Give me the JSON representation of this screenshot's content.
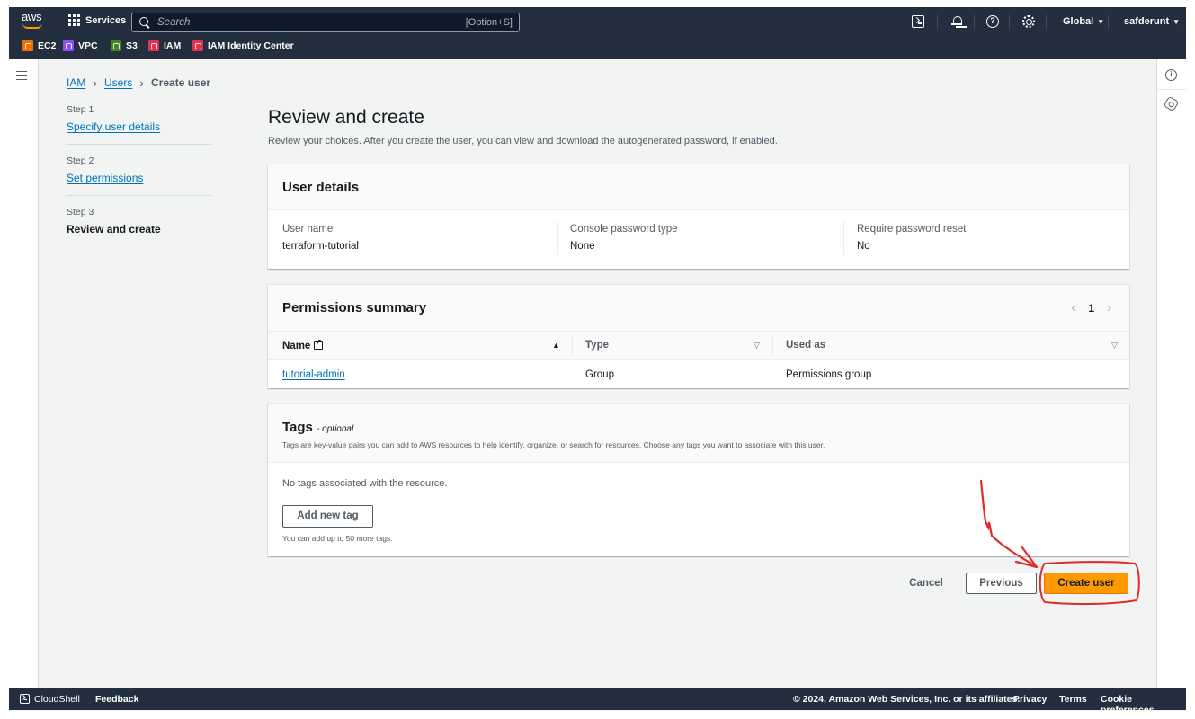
{
  "topnav": {
    "logo": "aws",
    "services_label": "Services",
    "search": {
      "placeholder": "Search",
      "shortcut": "[Option+S]"
    },
    "icons": [
      "cloudshell-icon",
      "bell-icon",
      "help-icon",
      "gear-icon"
    ],
    "region": "Global",
    "account": "safderunt",
    "favorites": [
      {
        "label": "EC2",
        "color": "#ed7100"
      },
      {
        "label": "VPC",
        "color": "#8c4fff"
      },
      {
        "label": "S3",
        "color": "#3f8624"
      },
      {
        "label": "IAM",
        "color": "#dd344c"
      },
      {
        "label": "IAM Identity Center",
        "color": "#dd344c"
      }
    ]
  },
  "breadcrumb": {
    "items": [
      {
        "label": "IAM",
        "link": true
      },
      {
        "label": "Users",
        "link": true
      },
      {
        "label": "Create user",
        "link": false
      }
    ]
  },
  "steps": [
    {
      "number": "Step 1",
      "label": "Specify user details",
      "state": "link"
    },
    {
      "number": "Step 2",
      "label": "Set permissions",
      "state": "link"
    },
    {
      "number": "Step 3",
      "label": "Review and create",
      "state": "current"
    }
  ],
  "page": {
    "title": "Review and create",
    "description": "Review your choices. After you create the user, you can view and download the autogenerated password, if enabled."
  },
  "user_details": {
    "title": "User details",
    "fields": [
      {
        "key": "User name",
        "value": "terraform-tutorial"
      },
      {
        "key": "Console password type",
        "value": "None"
      },
      {
        "key": "Require password reset",
        "value": "No"
      }
    ]
  },
  "permissions": {
    "title": "Permissions summary",
    "pagination": {
      "prev": "‹",
      "page": "1",
      "next": "›"
    },
    "columns": [
      {
        "label": "Name",
        "sort": "ascending"
      },
      {
        "label": "Type",
        "sort": "none"
      },
      {
        "label": "Used as",
        "sort": "none"
      }
    ],
    "rows": [
      {
        "name": "tutorial-admin",
        "type": "Group",
        "used_as": "Permissions group"
      }
    ]
  },
  "tags": {
    "title": "Tags",
    "optional": "- optional",
    "description": "Tags are key-value pairs you can add to AWS resources to help identify, organize, or search for resources. Choose any tags you want to associate with this user.",
    "empty": "No tags associated with the resource.",
    "add_button": "Add new tag",
    "hint": "You can add up to 50 more tags."
  },
  "actions": {
    "cancel": "Cancel",
    "previous": "Previous",
    "create": "Create user"
  },
  "annotation": {
    "color": "#e02b2b",
    "target": "Create user"
  },
  "footer": {
    "cloudshell": "CloudShell",
    "feedback": "Feedback",
    "copyright": "© 2024, Amazon Web Services, Inc. or its affiliates.",
    "privacy": "Privacy",
    "terms": "Terms",
    "cookies": "Cookie preferences"
  }
}
